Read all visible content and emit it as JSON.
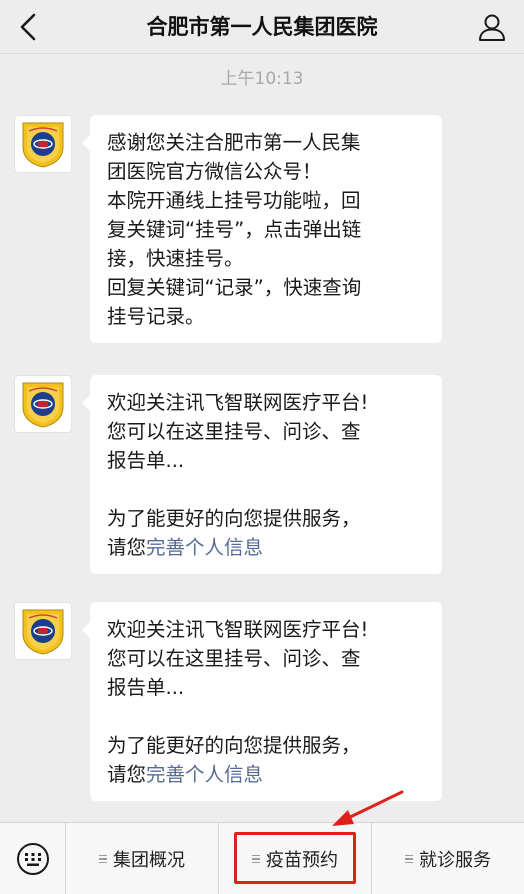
{
  "header": {
    "title": "合肥市第一人民集团医院",
    "back_icon": "chevron-left-icon",
    "profile_icon": "user-icon"
  },
  "chat": {
    "timestamp": "上午10:13",
    "messages": [
      {
        "avatar_icon": "hospital-logo-icon",
        "lines": [
          "感谢您关注合肥市第一人民集",
          "团医院官方微信公众号！",
          "本院开通线上挂号功能啦，回",
          "复关键词“挂号”，点击弹出链",
          "接，快速挂号。",
          "回复关键词“记录”，快速查询",
          "挂号记录。"
        ]
      },
      {
        "avatar_icon": "hospital-logo-icon",
        "lines": [
          "欢迎关注讯飞智联网医疗平台!",
          "您可以在这里挂号、问诊、查",
          "报告单..."
        ],
        "text_after_blank": "为了能更好的向您提供服务，",
        "link_prefix": "请您",
        "link_text": "完善个人信息"
      },
      {
        "avatar_icon": "hospital-logo-icon",
        "lines": [
          "欢迎关注讯飞智联网医疗平台!",
          "您可以在这里挂号、问诊、查",
          "报告单..."
        ],
        "text_after_blank": "为了能更好的向您提供服务，",
        "link_prefix": "请您",
        "link_text": "完善个人信息"
      }
    ]
  },
  "menu": {
    "keyboard_icon": "keyboard-icon",
    "items": [
      {
        "label": "集团概况"
      },
      {
        "label": "疫苗预约"
      },
      {
        "label": "就诊服务"
      }
    ],
    "menu_glyph_icon": "menu-lines-icon"
  },
  "annotation": {
    "color": "#e0201b",
    "highlighted_item": "疫苗预约"
  },
  "colors": {
    "background": "#ededed",
    "bubble": "#ffffff",
    "link": "#576b95",
    "timestamp": "#a8a8a8"
  }
}
